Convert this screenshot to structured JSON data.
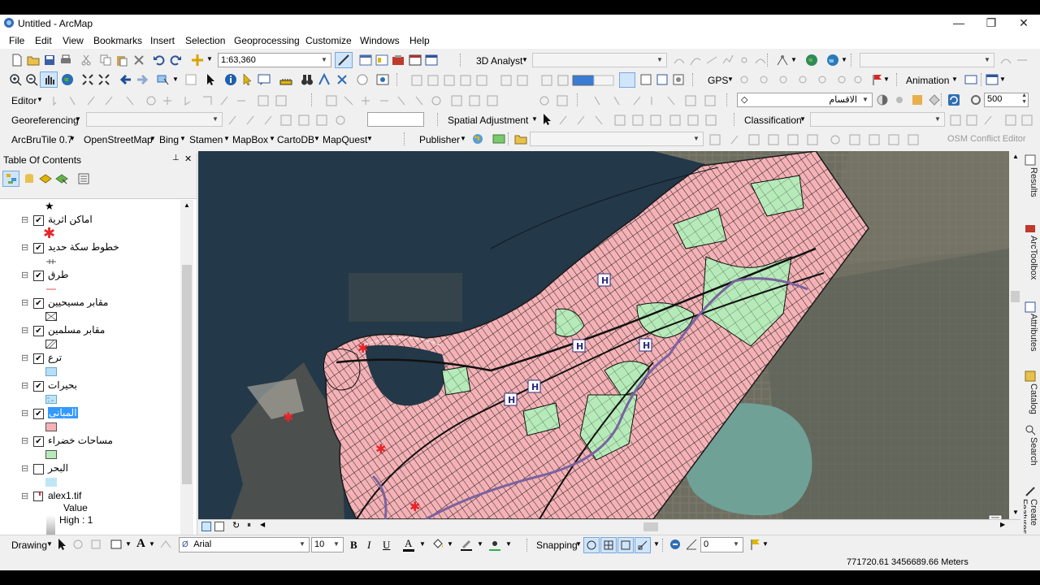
{
  "window": {
    "title": "Untitled - ArcMap"
  },
  "menu": [
    "File",
    "Edit",
    "View",
    "Bookmarks",
    "Insert",
    "Selection",
    "Geoprocessing",
    "Customize",
    "Windows",
    "Help"
  ],
  "toolbar1": {
    "scale": "1:63,360",
    "analyst_3d": "3D Analyst"
  },
  "toolbar2": {
    "gps": "GPS",
    "animation": "Animation"
  },
  "toolbar3": {
    "editor": "Editor",
    "layer_select": "الاقسام",
    "zoom_value": "500"
  },
  "toolbar4": {
    "georeferencing": "Georeferencing",
    "spatial_adjustment": "Spatial Adjustment",
    "classification": "Classification"
  },
  "toolbar5": {
    "arcbrutile": "ArcBruTile 0.7",
    "openstreetmap": "OpenStreetMap",
    "bing": "Bing",
    "stamen": "Stamen",
    "mapbox": "MapBox",
    "cartodb": "CartoDB",
    "mapquest": "MapQuest",
    "publisher": "Publisher",
    "osm_conflict": "OSM Conflict Editor"
  },
  "toc": {
    "title": "Table Of Contents",
    "pin": "ᚹ",
    "close": "✕",
    "layers": [
      {
        "name": "اماكن اثرية",
        "checked": true
      },
      {
        "name": "خطوط سكة حديد",
        "checked": true
      },
      {
        "name": "طرق",
        "checked": true
      },
      {
        "name": "مقابر مسيحيين",
        "checked": true
      },
      {
        "name": "مقابر مسلمين",
        "checked": true
      },
      {
        "name": "ترع",
        "checked": true
      },
      {
        "name": "بحيرات",
        "checked": true
      },
      {
        "name": "المبانى",
        "checked": true
      },
      {
        "name": "مساحات خضراء",
        "checked": true
      },
      {
        "name": "البحر",
        "checked": false
      }
    ],
    "raster": {
      "name": "alex1.tif",
      "value_label": "Value",
      "high_label": "High : 1"
    }
  },
  "drawing": {
    "drawing": "Drawing",
    "font": "Arial",
    "size": "10",
    "snapping": "Snapping",
    "angle": "0"
  },
  "status": {
    "coordinates": "771720.61  3456689.66 Meters"
  },
  "dock": [
    "Results",
    "ArcToolbox",
    "Attributes",
    "Catalog",
    "Search",
    "Create Features"
  ],
  "colors": {
    "buildings": "#f5b2b6",
    "green_areas": "#b6ebb9",
    "sea_sat": "#233848",
    "land_sat": "#6d6e61",
    "lake": "#6fa197",
    "lake_symbol": "#bfe6f7",
    "canal_symbol": "#b5dff7",
    "roads": "#1a1a1a",
    "canals": "#7a62a0",
    "landmark": "#e8242b",
    "highlight": "#3399ff"
  },
  "map_labels": [
    "H",
    "H",
    "H",
    "H",
    "H"
  ]
}
